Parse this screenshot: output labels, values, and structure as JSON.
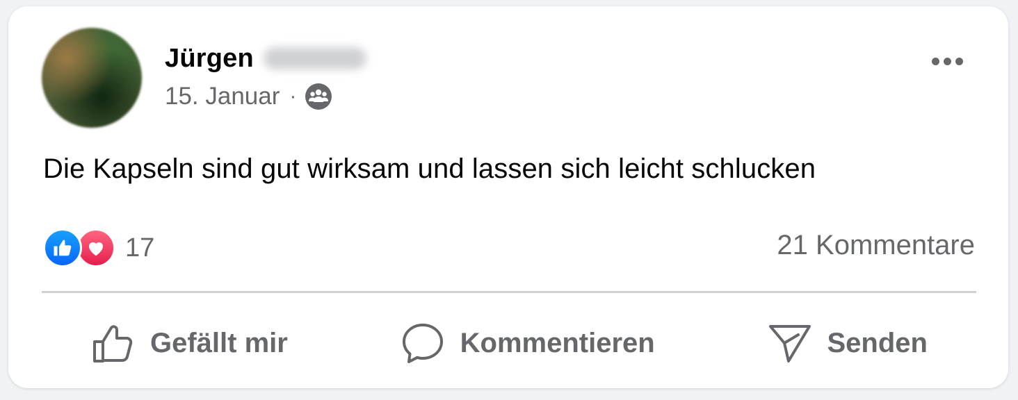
{
  "post": {
    "author_first_name": "Jürgen",
    "date": "15. Januar",
    "separator": "·",
    "audience_icon": "group-icon",
    "text": "Die Kapseln sind gut wirksam und lassen sich leicht schlucken"
  },
  "reactions": {
    "types": [
      "like-icon",
      "love-icon"
    ],
    "count": "17",
    "comments_label": "21 Kommentare"
  },
  "actions": {
    "like_label": "Gefällt mir",
    "comment_label": "Kommentieren",
    "send_label": "Senden"
  },
  "colors": {
    "text_primary": "#050505",
    "text_secondary": "#65676b",
    "like_blue": "#0866ff",
    "love_red": "#e61e4d",
    "divider": "#ced0d4"
  }
}
